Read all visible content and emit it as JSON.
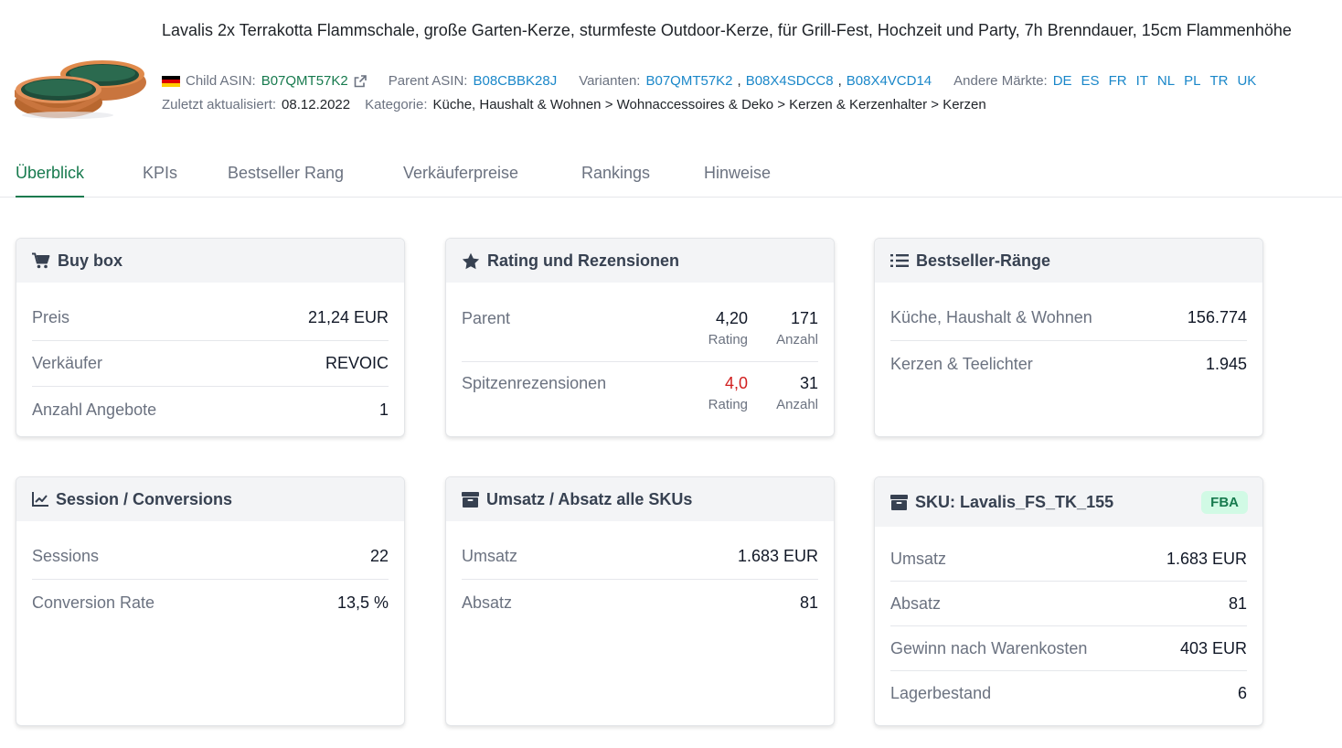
{
  "product": {
    "title": "Lavalis 2x Terrakotta Flammschale, große Garten-Kerze, sturmfeste Outdoor-Kerze, für Grill-Fest, Hochzeit und Party, 7h Brenndauer, 15cm Flammenhöhe",
    "child_asin_label": "Child ASIN:",
    "child_asin": "B07QMT57K2",
    "parent_asin_label": "Parent ASIN:",
    "parent_asin": "B08CBBK28J",
    "variants_label": "Varianten:",
    "variants": [
      "B07QMT57K2",
      "B08X4SDCC8",
      "B08X4VCD14"
    ],
    "markets_label": "Andere Märkte:",
    "markets": [
      "DE",
      "ES",
      "FR",
      "IT",
      "NL",
      "PL",
      "TR",
      "UK"
    ],
    "updated_label": "Zuletzt aktualisiert:",
    "updated": "08.12.2022",
    "category_label": "Kategorie:",
    "category": "Küche, Haushalt & Wohnen > Wohnaccessoires & Deko > Kerzen & Kerzenhalter > Kerzen",
    "flag_colors": [
      "#000000",
      "#dd0000",
      "#ffce00"
    ]
  },
  "tabs": [
    "Überblick",
    "KPIs",
    "Bestseller Rang",
    "Verkäuferpreise",
    "Rankings",
    "Hinweise"
  ],
  "cards": {
    "buybox": {
      "title": "Buy box",
      "rows": [
        {
          "label": "Preis",
          "value": "21,24 EUR"
        },
        {
          "label": "Verkäufer",
          "value": "REVOIC"
        },
        {
          "label": "Anzahl Angebote",
          "value": "1"
        }
      ]
    },
    "rating": {
      "title": "Rating und Rezensionen",
      "rows": [
        {
          "label": "Parent",
          "rating": "4,20",
          "count": "171",
          "rating_label": "Rating",
          "count_label": "Anzahl"
        },
        {
          "label": "Spitzenrezensionen",
          "rating": "4,0",
          "count": "31",
          "rating_label": "Rating",
          "count_label": "Anzahl"
        }
      ]
    },
    "bestseller": {
      "title": "Bestseller-Ränge",
      "rows": [
        {
          "label": "Küche, Haushalt & Wohnen",
          "value": "156.774"
        },
        {
          "label": "Kerzen & Teelichter",
          "value": "1.945"
        }
      ]
    },
    "session": {
      "title": "Session / Conversions",
      "rows": [
        {
          "label": "Sessions",
          "value": "22"
        },
        {
          "label": "Conversion Rate",
          "value": "13,5 %"
        }
      ]
    },
    "umsatz": {
      "title": "Umsatz / Absatz alle SKUs",
      "rows": [
        {
          "label": "Umsatz",
          "value": "1.683 EUR"
        },
        {
          "label": "Absatz",
          "value": "81"
        }
      ]
    },
    "sku": {
      "title": "SKU: Lavalis_FS_TK_155",
      "badge": "FBA",
      "rows": [
        {
          "label": "Umsatz",
          "value": "1.683 EUR"
        },
        {
          "label": "Absatz",
          "value": "81"
        },
        {
          "label": "Gewinn nach Warenkosten",
          "value": "403 EUR"
        },
        {
          "label": "Lagerbestand",
          "value": "6"
        }
      ]
    }
  },
  "colors": {
    "accent_green": "#177a4e",
    "link_blue": "#1a87c9",
    "alert_red": "#d11f1f"
  }
}
